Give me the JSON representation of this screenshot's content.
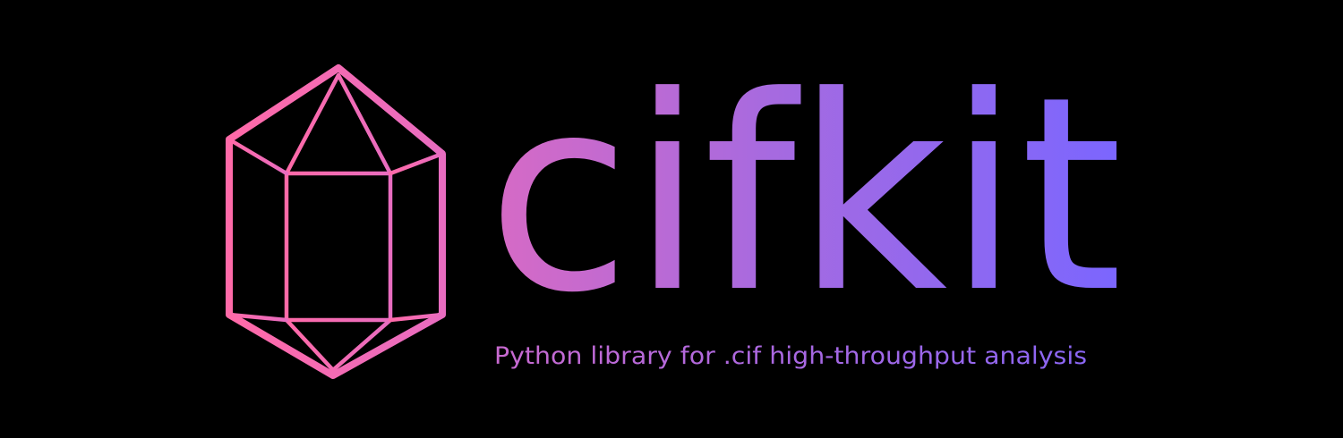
{
  "brand": {
    "name": "cifkit",
    "tagline": "Python library for .cif high-throughput analysis"
  },
  "colors": {
    "background": "#000000",
    "gradient_start": "#ff6aa8",
    "gradient_mid": "#b46ad8",
    "gradient_end": "#7a66ff"
  },
  "icons": {
    "logo": "crystal-icon"
  }
}
